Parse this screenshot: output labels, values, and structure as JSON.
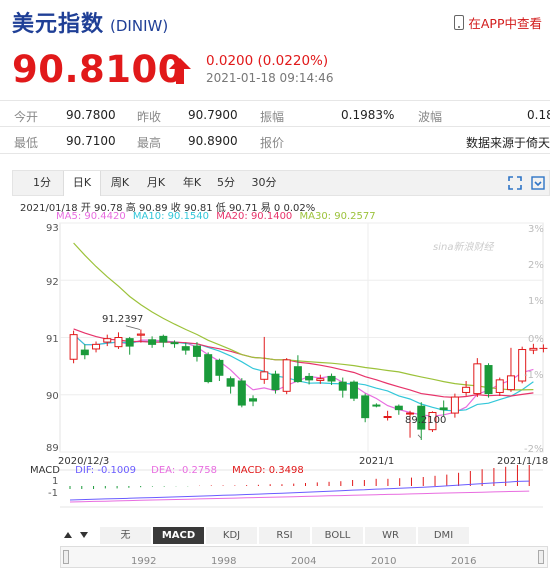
{
  "header": {
    "name": "美元指数",
    "code": "(DINIW)",
    "app_link": "在APP中查看"
  },
  "quote": {
    "price": "90.8100",
    "change": "0.0200 (0.0220%)",
    "time": "2021-01-18 09:14:46"
  },
  "stats": {
    "row1": [
      {
        "label": "今开",
        "value": "90.7800"
      },
      {
        "label": "昨收",
        "value": "90.7900"
      },
      {
        "label": "振幅",
        "value": "0.1983%"
      },
      {
        "label": "波幅",
        "value": "0.18"
      }
    ],
    "row2": [
      {
        "label": "最低",
        "value": "90.7100"
      },
      {
        "label": "最高",
        "value": "90.8900"
      },
      {
        "label": "报价",
        "value": ""
      },
      {
        "label": "",
        "value": "数据来源于倚天"
      }
    ]
  },
  "tabs": [
    "1分",
    "日K",
    "周K",
    "月K",
    "年K",
    "5分",
    "30分"
  ],
  "active_tab": "日K",
  "kline_info": "2021/01/18 开 90.78 高 90.89 收 90.81 低 90.71 易 0 0.02%",
  "ma": {
    "ma5": "MA5: 90.4420",
    "ma10": "MA10: 90.1540",
    "ma20": "MA20: 90.1400",
    "ma30": "MA30: 90.2577"
  },
  "chart": {
    "y_labels": [
      "93",
      "92",
      "91",
      "90",
      "89"
    ],
    "right_labels": [
      "3%",
      "2%",
      "1%",
      "0%",
      "-1%",
      "-2%"
    ],
    "x_labels": [
      "2020/12/3",
      "2021/1",
      "2021/1/18"
    ],
    "high_label": "91.2397",
    "low_label": "89.2100",
    "watermark": "sina新浪财经"
  },
  "macd": {
    "name": "MACD",
    "dif": "DIF: -0.1009",
    "dea": "DEA: -0.2758",
    "macd": "MACD: 0.3498",
    "y_labels": [
      "1",
      "-1"
    ]
  },
  "indicator_tabs": [
    "无",
    "MACD",
    "KDJ",
    "RSI",
    "BOLL",
    "WR",
    "DMI"
  ],
  "active_indicator": "MACD",
  "navigator_years": [
    "1992",
    "1998",
    "2004",
    "2010",
    "2016"
  ],
  "colors": {
    "up": "#e1191a",
    "down": "#1a9a3a",
    "ma5": "#e86de0",
    "ma10": "#33c7d9",
    "ma20": "#e7336a",
    "ma30": "#9cc23a",
    "brand": "#1f3f96"
  },
  "chart_data": {
    "type": "candlestick",
    "y_range": [
      89,
      93
    ],
    "candles": [
      [
        90.62,
        91.05,
        90.55,
        91.12
      ],
      [
        90.78,
        90.7,
        90.62,
        90.88
      ],
      [
        90.8,
        90.88,
        90.74,
        90.93
      ],
      [
        90.92,
        90.98,
        90.85,
        91.05
      ],
      [
        90.84,
        91.0,
        90.8,
        91.09
      ],
      [
        90.98,
        90.85,
        90.7,
        91.01
      ],
      [
        91.04,
        91.06,
        90.91,
        91.14
      ],
      [
        90.96,
        90.88,
        90.82,
        91.02
      ],
      [
        91.02,
        90.92,
        90.83,
        91.05
      ],
      [
        90.91,
        90.9,
        90.82,
        90.95
      ],
      [
        90.84,
        90.78,
        90.7,
        90.91
      ],
      [
        90.85,
        90.67,
        90.58,
        90.92
      ],
      [
        90.7,
        90.23,
        90.2,
        90.74
      ],
      [
        90.6,
        90.34,
        90.24,
        90.63
      ],
      [
        90.28,
        90.15,
        90.02,
        90.32
      ],
      [
        90.24,
        89.82,
        89.78,
        90.29
      ],
      [
        89.93,
        89.89,
        89.8,
        89.99
      ],
      [
        90.27,
        90.4,
        90.19,
        91.01
      ],
      [
        90.36,
        90.09,
        90.02,
        90.42
      ],
      [
        90.06,
        90.61,
        90.01,
        90.64
      ],
      [
        90.49,
        90.23,
        90.21,
        90.69
      ],
      [
        90.32,
        90.26,
        90.18,
        90.38
      ],
      [
        90.25,
        90.28,
        90.19,
        90.35
      ],
      [
        90.32,
        90.24,
        90.17,
        90.37
      ],
      [
        90.22,
        90.08,
        89.95,
        90.3
      ],
      [
        90.22,
        89.94,
        89.89,
        90.25
      ],
      [
        89.98,
        89.6,
        89.52,
        90.02
      ],
      [
        89.82,
        89.81,
        89.78,
        89.85
      ],
      [
        89.61,
        89.62,
        89.55,
        89.72
      ],
      [
        89.8,
        89.74,
        89.65,
        89.83
      ],
      [
        89.68,
        89.68,
        89.25,
        89.72
      ],
      [
        89.8,
        89.4,
        89.21,
        89.87
      ],
      [
        89.39,
        89.69,
        89.35,
        89.71
      ],
      [
        89.77,
        89.74,
        89.62,
        89.9
      ],
      [
        89.68,
        89.96,
        89.6,
        90.02
      ],
      [
        90.04,
        90.13,
        89.98,
        90.24
      ],
      [
        90.02,
        90.54,
        89.96,
        90.64
      ],
      [
        90.51,
        90.02,
        89.95,
        90.55
      ],
      [
        90.04,
        90.26,
        89.98,
        90.3
      ],
      [
        90.09,
        90.33,
        90.05,
        90.82
      ],
      [
        90.24,
        90.79,
        90.2,
        90.84
      ],
      [
        90.78,
        90.81,
        90.71,
        90.89
      ]
    ],
    "macd_hist": [
      -0.05,
      -0.05,
      -0.05,
      -0.04,
      -0.04,
      -0.03,
      -0.02,
      -0.01,
      -0.01,
      -0.005,
      -0.005,
      0.005,
      0.01,
      0.01,
      0.01,
      0.015,
      0.02,
      0.03,
      0.03,
      0.04,
      0.05,
      0.06,
      0.07,
      0.08,
      0.1,
      0.1,
      0.12,
      0.12,
      0.13,
      0.14,
      0.15,
      0.17,
      0.19,
      0.22,
      0.25,
      0.28,
      0.3,
      0.32,
      0.35,
      0.35
    ],
    "macd_neg": [
      -0.55,
      -0.5,
      -0.46,
      -0.4
    ]
  }
}
